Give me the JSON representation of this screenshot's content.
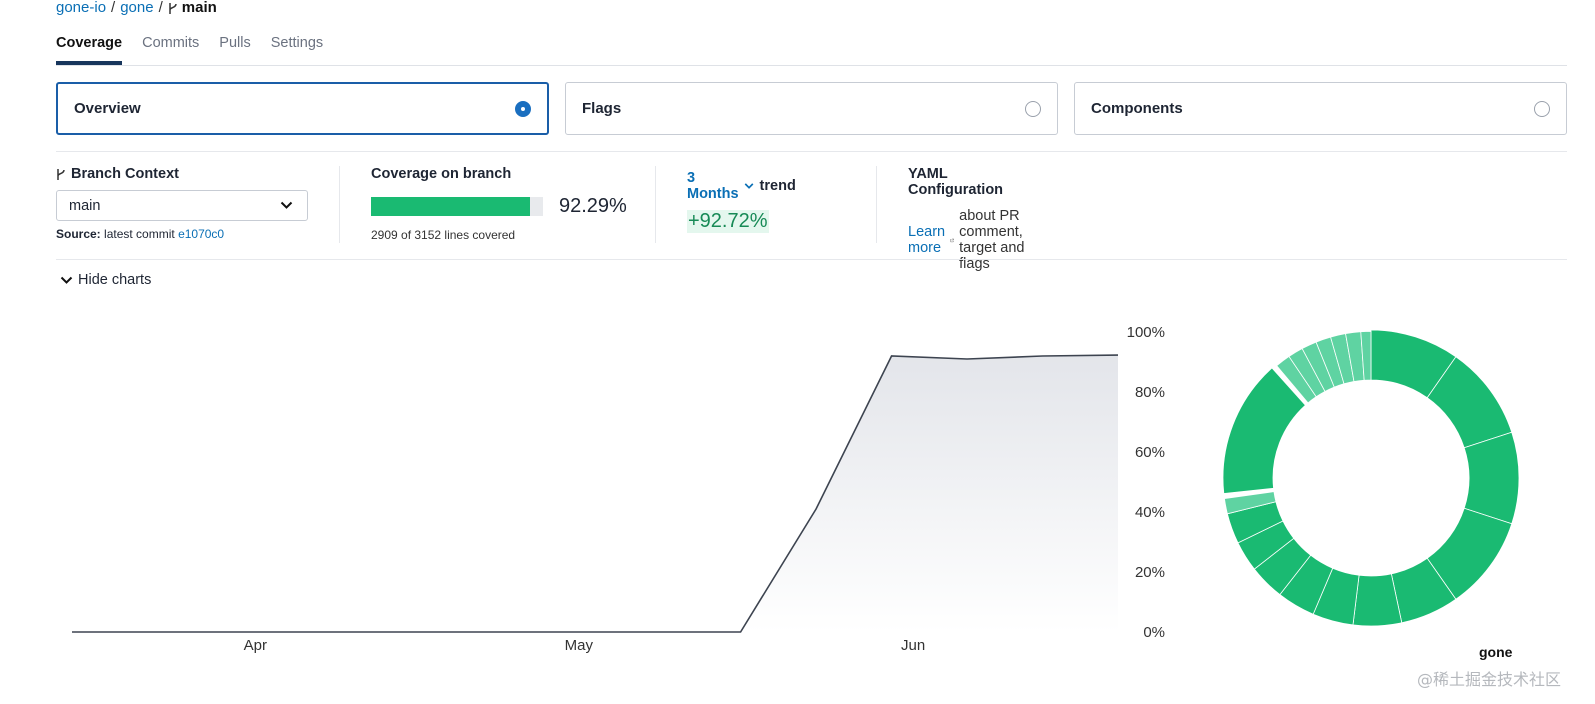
{
  "breadcrumb": {
    "org": "gone-io",
    "repo": "gone",
    "branch": "main",
    "separator": "/"
  },
  "tabs": [
    {
      "label": "Coverage",
      "active": true
    },
    {
      "label": "Commits",
      "active": false
    },
    {
      "label": "Pulls",
      "active": false
    },
    {
      "label": "Settings",
      "active": false
    }
  ],
  "cards": [
    {
      "label": "Overview",
      "selected": true
    },
    {
      "label": "Flags",
      "selected": false
    },
    {
      "label": "Components",
      "selected": false
    }
  ],
  "branch_context": {
    "title": "Branch Context",
    "selected": "main",
    "source_label": "Source:",
    "source_text": "latest commit",
    "commit": "e1070c0"
  },
  "coverage": {
    "title": "Coverage on branch",
    "percent": 92.29,
    "percent_text": "92.29%",
    "lines_text": "2909 of 3152 lines covered"
  },
  "trend": {
    "period": "3 Months",
    "label": "trend",
    "value": "+92.72%"
  },
  "yaml": {
    "title": "YAML Configuration",
    "link": "Learn more",
    "suffix": "about PR comment, target and flags"
  },
  "hide_charts": "Hide charts",
  "sunburst_label": "gone",
  "watermark": "@稀土掘金技术社区",
  "colors": {
    "accent": "#0a6fb5",
    "covered": "#1aba72",
    "partial": "#5fd3a2",
    "line": "#3d4450"
  },
  "chart_data": {
    "type": "area",
    "x_ticks": [
      "Apr",
      "May",
      "Jun"
    ],
    "y_ticks": [
      "0%",
      "20%",
      "40%",
      "60%",
      "80%",
      "100%"
    ],
    "ylim": [
      0,
      100
    ],
    "x": [
      "2023-03-15",
      "2023-05-16",
      "2023-05-23",
      "2023-05-30",
      "2023-06-06",
      "2023-06-13",
      "2023-06-20"
    ],
    "values": [
      0,
      0,
      41,
      92,
      91,
      92,
      92.3
    ],
    "xlim": [
      "2023-03-15",
      "2023-06-20"
    ],
    "grid": false
  }
}
